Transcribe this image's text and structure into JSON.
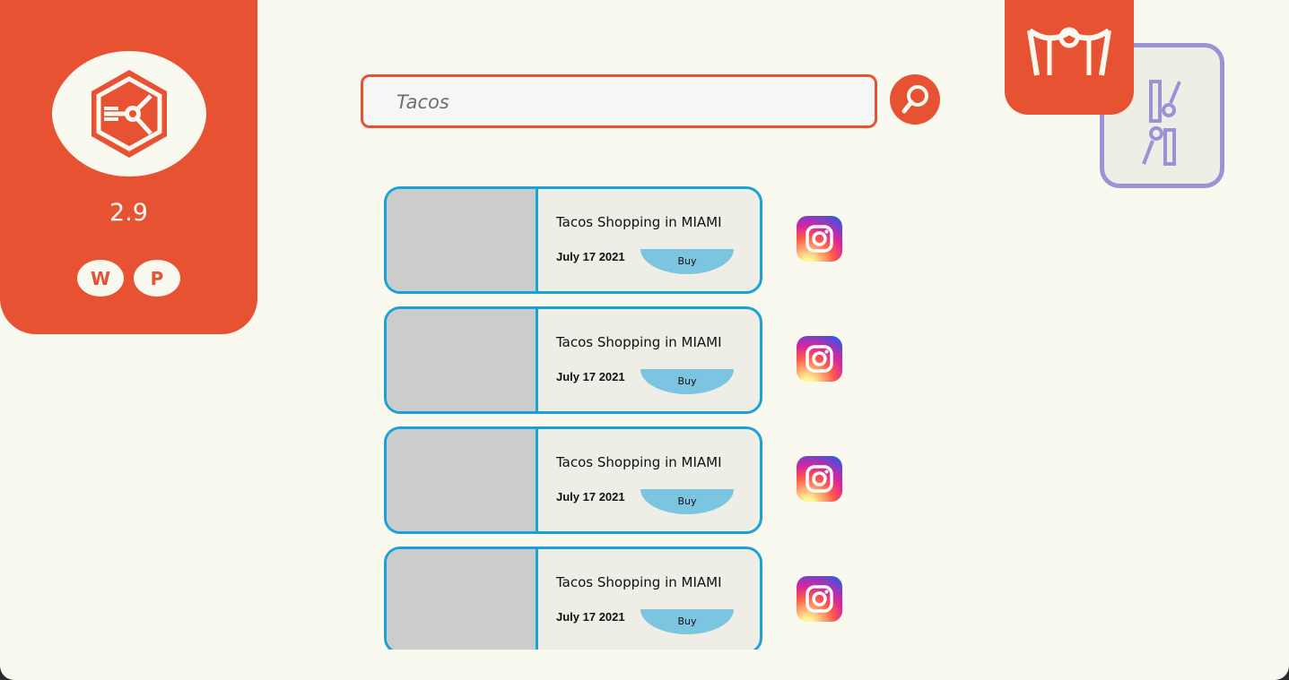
{
  "sidebar": {
    "rating": "2.9",
    "social": [
      {
        "label": "W",
        "icon": "w-brand-icon"
      },
      {
        "label": "P",
        "icon": "p-brand-icon"
      }
    ]
  },
  "search": {
    "value": "Tacos",
    "placeholder": "Tacos"
  },
  "results": [
    {
      "title": "Tacos Shopping in MIAMI",
      "date": "July 17 2021",
      "buy_label": "Buy"
    },
    {
      "title": "Tacos Shopping in MIAMI",
      "date": "July 17 2021",
      "buy_label": "Buy"
    },
    {
      "title": "Tacos Shopping in MIAMI",
      "date": "July 17 2021",
      "buy_label": "Buy"
    },
    {
      "title": "Tacos Shopping in MIAMI",
      "date": "July 17 2021",
      "buy_label": "Buy"
    }
  ],
  "colors": {
    "accent": "#e75233",
    "background": "#faf9f0",
    "card_border": "#1aa2d6",
    "buy_button": "#7cc5e0",
    "tools_border": "#9f91d6"
  }
}
